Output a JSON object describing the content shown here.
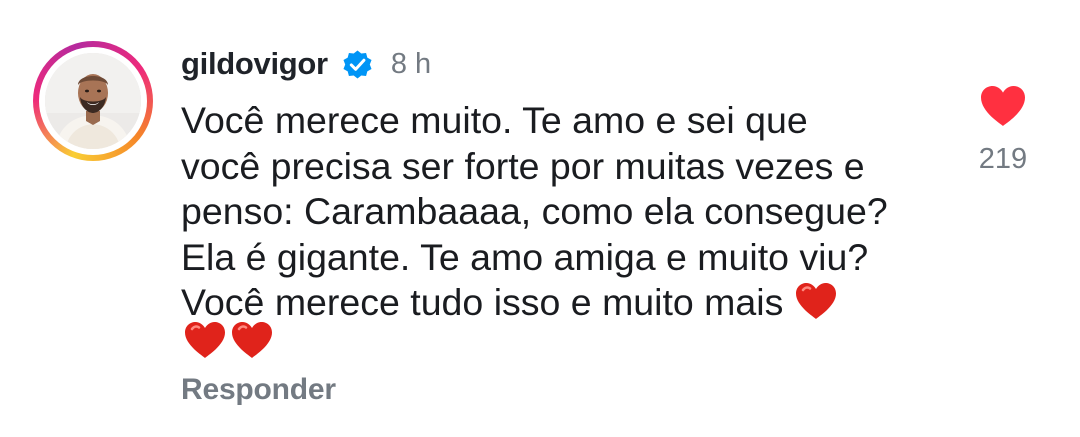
{
  "comment": {
    "username": "gildovigor",
    "verified_icon": "verified-badge-icon",
    "timestamp": "8 h",
    "text": "Você merece muito. Te amo e sei que\nvocê precisa ser forte por muitas vezes e\npenso: Carambaaaa, como ela consegue?\nEla é gigante. Te amo amiga e muito viu?\nVocê merece tudo isso e muito mais",
    "trailing_emoji": "❤️",
    "extra_emojis": [
      "❤️",
      "❤️"
    ],
    "reply_label": "Responder",
    "like_count": "219",
    "like_icon": "heart-icon",
    "colors": {
      "like": "#ff3040",
      "verified": "#0095f6",
      "muted_text": "#737a82"
    }
  }
}
